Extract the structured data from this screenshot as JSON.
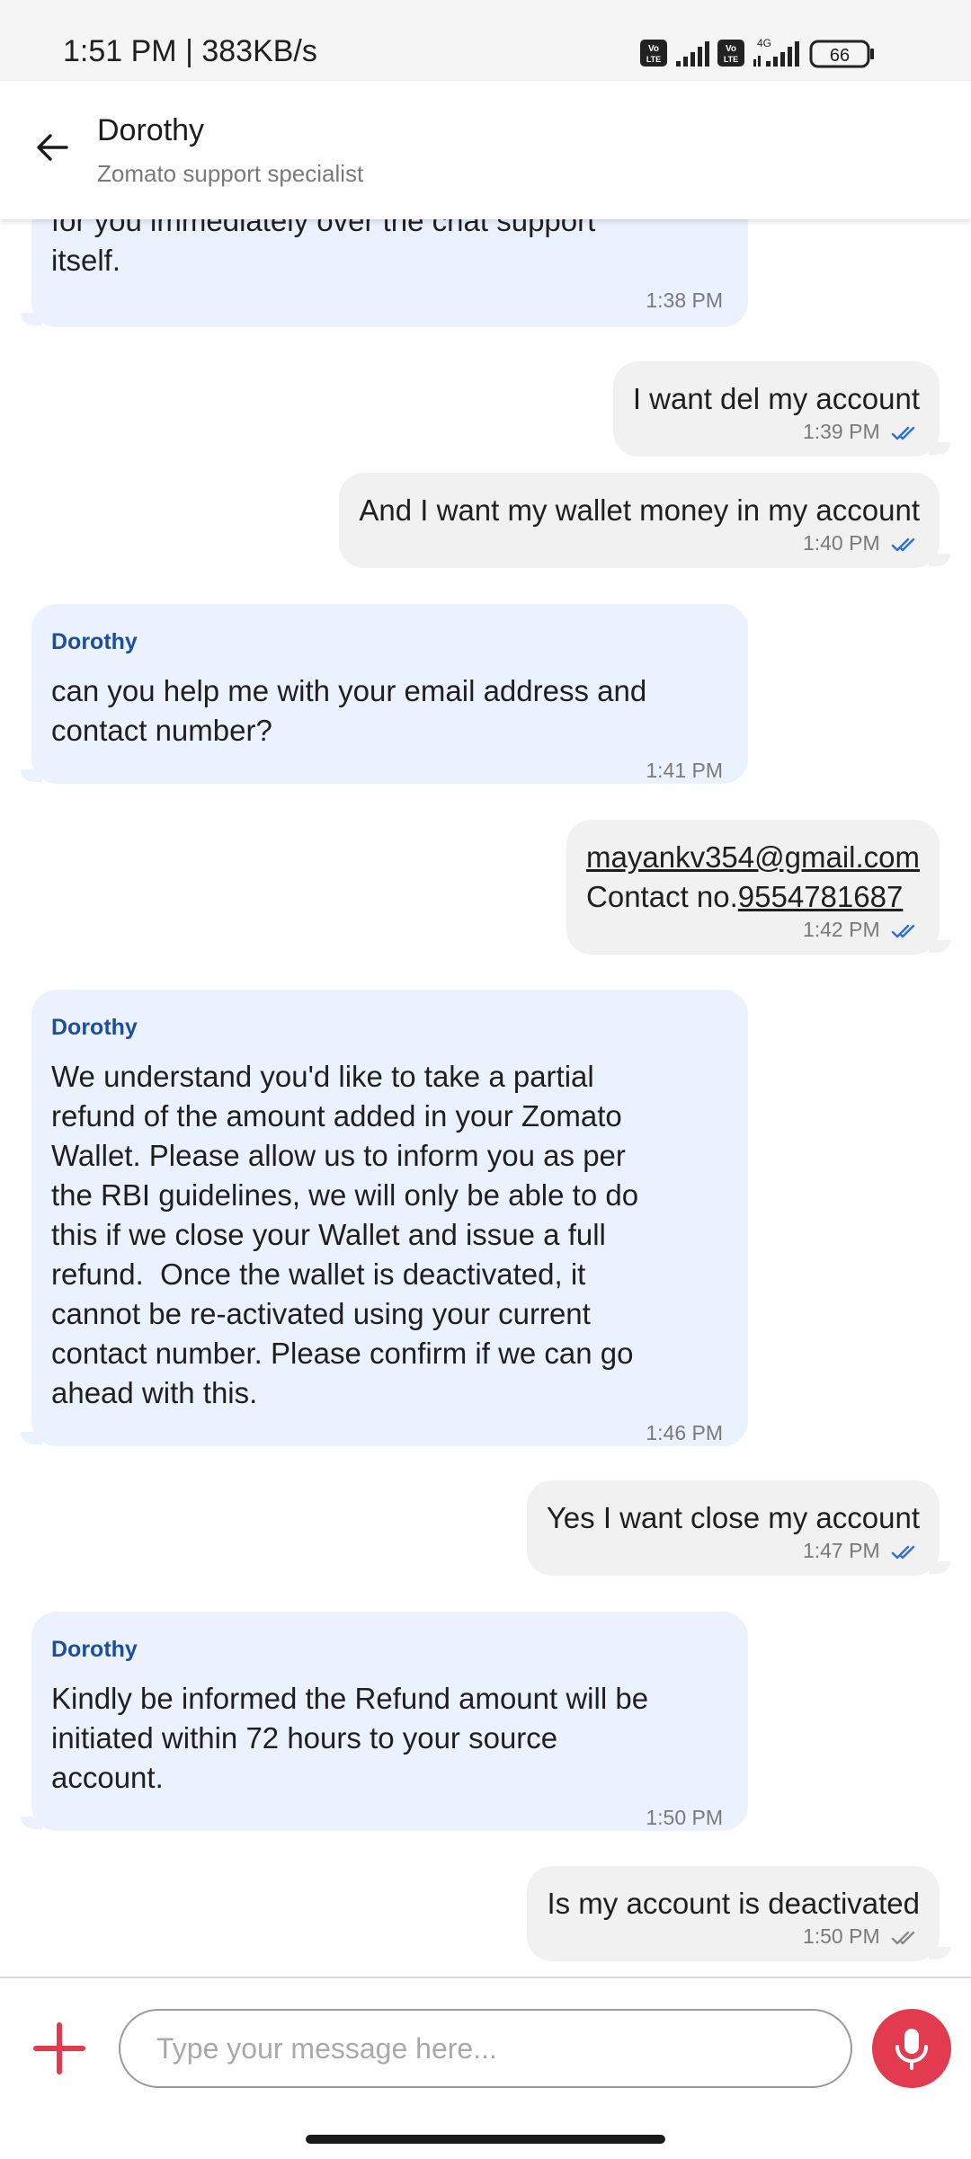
{
  "status_bar": {
    "time": "1:51 PM | 383KB/s",
    "battery": "66",
    "network": "4G",
    "icons": [
      "volte-icon",
      "signal-icon",
      "volte-icon",
      "4g-signal-icon",
      "battery-icon"
    ]
  },
  "header": {
    "name": "Dorothy",
    "subtitle": "Zomato support specialist"
  },
  "messages": [
    {
      "direction": "in",
      "sender": "",
      "text": "for you immediately over the chat support\nitself.",
      "time": "1:38 PM"
    },
    {
      "direction": "out",
      "text": "I want del my account",
      "time": "1:39 PM",
      "status": "read"
    },
    {
      "direction": "out",
      "text": "And I want my wallet money in my account",
      "time": "1:40 PM",
      "status": "read"
    },
    {
      "direction": "in",
      "sender": "Dorothy",
      "text": "can you help me with your email address and\ncontact number?",
      "time": "1:41 PM"
    },
    {
      "direction": "out",
      "email": "mayankv354@gmail.com",
      "contact_prefix": "Contact no.",
      "contact_number": "9554781687",
      "time": "1:42 PM",
      "status": "read"
    },
    {
      "direction": "in",
      "sender": "Dorothy",
      "text": "We understand you'd like to take a partial\nrefund of the amount added in your Zomato\nWallet. Please allow us to inform you as per\nthe RBI guidelines, we will only be able to do\nthis if we close your Wallet and issue a full\nrefund.  Once the wallet is deactivated, it\ncannot be re-activated using your current\ncontact number. Please confirm if we can go\nahead with this.",
      "time": "1:46 PM"
    },
    {
      "direction": "out",
      "text": "Yes I want close my account",
      "time": "1:47 PM",
      "status": "read"
    },
    {
      "direction": "in",
      "sender": "Dorothy",
      "text": "Kindly be informed the Refund amount will be\ninitiated within 72 hours to your source\naccount.",
      "time": "1:50 PM"
    },
    {
      "direction": "out",
      "text": "Is my account is deactivated",
      "time": "1:50 PM",
      "status": "delivered"
    }
  ],
  "input": {
    "placeholder": "Type your message here..."
  },
  "colors": {
    "incoming_bubble": "#ebf2fe",
    "outgoing_bubble": "#f1f1f1",
    "sender_name": "#1d4e9e",
    "read_tick": "#2f6fd6",
    "delivered_tick": "#8a8a8a",
    "accent": "#e23b4f"
  }
}
